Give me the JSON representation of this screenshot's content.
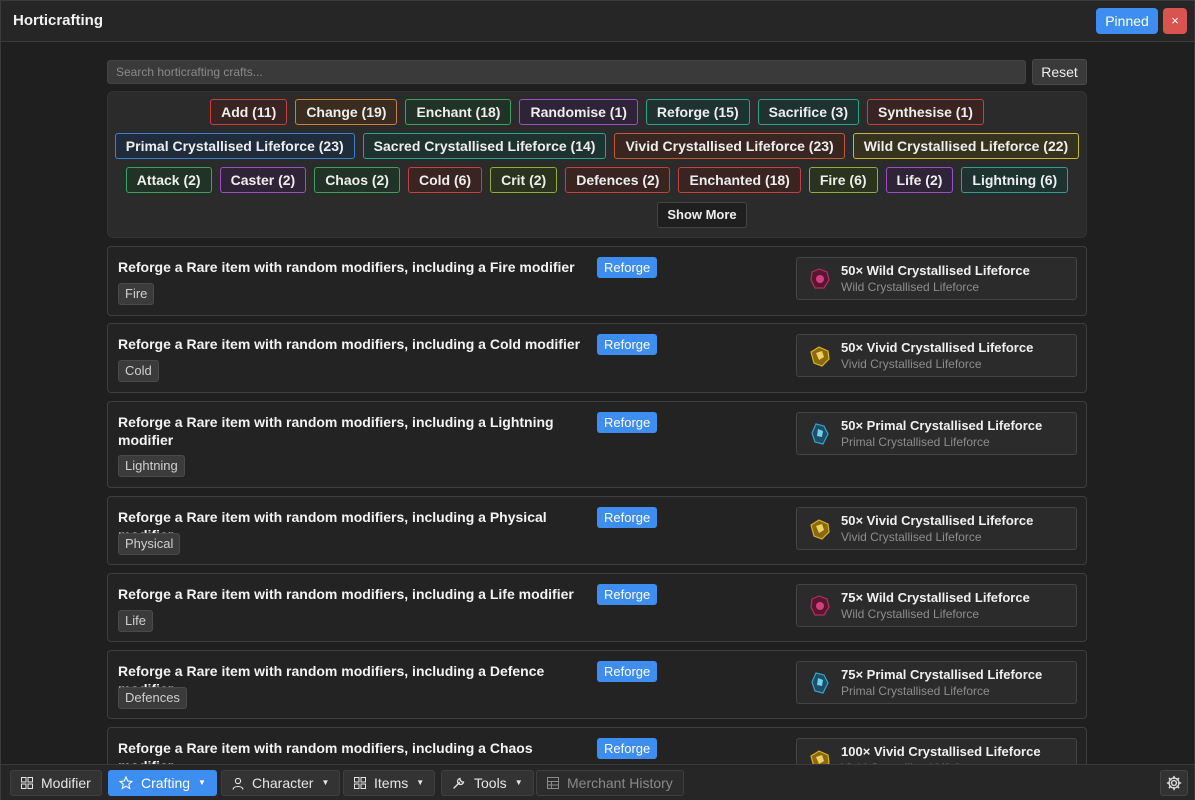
{
  "window": {
    "title": "Horticrafting",
    "pinned_label": "Pinned",
    "close_label": "×"
  },
  "search": {
    "placeholder": "Search horticrafting crafts...",
    "value": "",
    "reset_label": "Reset"
  },
  "filters": {
    "row1": [
      {
        "label": "Add (11)",
        "color": "red"
      },
      {
        "label": "Change (19)",
        "color": "orange"
      },
      {
        "label": "Enchant (18)",
        "color": "green"
      },
      {
        "label": "Randomise (1)",
        "color": "purple"
      },
      {
        "label": "Reforge (15)",
        "color": "teal"
      },
      {
        "label": "Sacrifice (3)",
        "color": "teal"
      },
      {
        "label": "Synthesise (1)",
        "color": "red"
      }
    ],
    "row2": [
      {
        "label": "Primal Crystallised Lifeforce (23)",
        "color": "blue"
      },
      {
        "label": "Sacred Crystallised Lifeforce (14)",
        "color": "teal"
      },
      {
        "label": "Vivid Crystallised Lifeforce (23)",
        "color": "rust"
      },
      {
        "label": "Wild Crystallised Lifeforce (22)",
        "color": "yellow"
      }
    ],
    "row3": [
      {
        "label": "Attack (2)",
        "color": "green"
      },
      {
        "label": "Caster (2)",
        "color": "purple"
      },
      {
        "label": "Chaos (2)",
        "color": "green"
      },
      {
        "label": "Cold (6)",
        "color": "red"
      },
      {
        "label": "Crit (2)",
        "color": "lime"
      },
      {
        "label": "Defences (2)",
        "color": "red"
      },
      {
        "label": "Enchanted (18)",
        "color": "red"
      },
      {
        "label": "Fire (6)",
        "color": "lime"
      },
      {
        "label": "Life (2)",
        "color": "purple"
      },
      {
        "label": "Lightning (6)",
        "color": "teal"
      }
    ],
    "show_more_label": "Show More"
  },
  "crafts": [
    {
      "title": "Reforge a Rare item with random modifiers, including a Fire modifier",
      "tag": "Fire",
      "badge": "Reforge",
      "cost": "50× Wild Crystallised Lifeforce",
      "currency": "Wild Crystallised Lifeforce",
      "icon": "wild-lifeforce-icon"
    },
    {
      "title": "Reforge a Rare item with random modifiers, including a Cold modifier",
      "tag": "Cold",
      "badge": "Reforge",
      "cost": "50× Vivid Crystallised Lifeforce",
      "currency": "Vivid Crystallised Lifeforce",
      "icon": "vivid-lifeforce-icon"
    },
    {
      "title": "Reforge a Rare item with random modifiers, including a Lightning modifier",
      "tag": "Lightning",
      "badge": "Reforge",
      "cost": "50× Primal Crystallised Lifeforce",
      "currency": "Primal Crystallised Lifeforce",
      "icon": "primal-lifeforce-icon"
    },
    {
      "title": "Reforge a Rare item with random modifiers, including a Physical modifier",
      "tag": "Physical",
      "badge": "Reforge",
      "cost": "50× Vivid Crystallised Lifeforce",
      "currency": "Vivid Crystallised Lifeforce",
      "icon": "vivid-lifeforce-icon"
    },
    {
      "title": "Reforge a Rare item with random modifiers, including a Life modifier",
      "tag": "Life",
      "badge": "Reforge",
      "cost": "75× Wild Crystallised Lifeforce",
      "currency": "Wild Crystallised Lifeforce",
      "icon": "wild-lifeforce-icon"
    },
    {
      "title": "Reforge a Rare item with random modifiers, including a Defence modifier",
      "tag": "Defences",
      "badge": "Reforge",
      "cost": "75× Primal Crystallised Lifeforce",
      "currency": "Primal Crystallised Lifeforce",
      "icon": "primal-lifeforce-icon"
    },
    {
      "title": "Reforge a Rare item with random modifiers, including a Chaos modifier",
      "tag": "Chaos",
      "badge": "Reforge",
      "cost": "100× Vivid Crystallised Lifeforce",
      "currency": "Vivid Crystallised Lifeforce",
      "icon": "vivid-lifeforce-icon"
    }
  ],
  "bottom_nav": [
    {
      "label": "Modifier",
      "icon": "grid-icon",
      "caret": false,
      "state": "normal"
    },
    {
      "label": "Crafting",
      "icon": "star-icon",
      "caret": true,
      "state": "active"
    },
    {
      "label": "Character",
      "icon": "person-icon",
      "caret": true,
      "state": "normal"
    },
    {
      "label": "Items",
      "icon": "grid-icon",
      "caret": true,
      "state": "normal"
    },
    {
      "label": "Tools",
      "icon": "wrench-icon",
      "caret": true,
      "state": "normal"
    },
    {
      "label": "Merchant History",
      "icon": "table-icon",
      "caret": false,
      "state": "disabled"
    }
  ],
  "settings_icon": "gear-icon",
  "colors": {
    "accent": "#3d8ef0",
    "close": "#d9534f",
    "wild": "#b03060",
    "vivid": "#e0b020",
    "primal": "#3aa0c8"
  }
}
